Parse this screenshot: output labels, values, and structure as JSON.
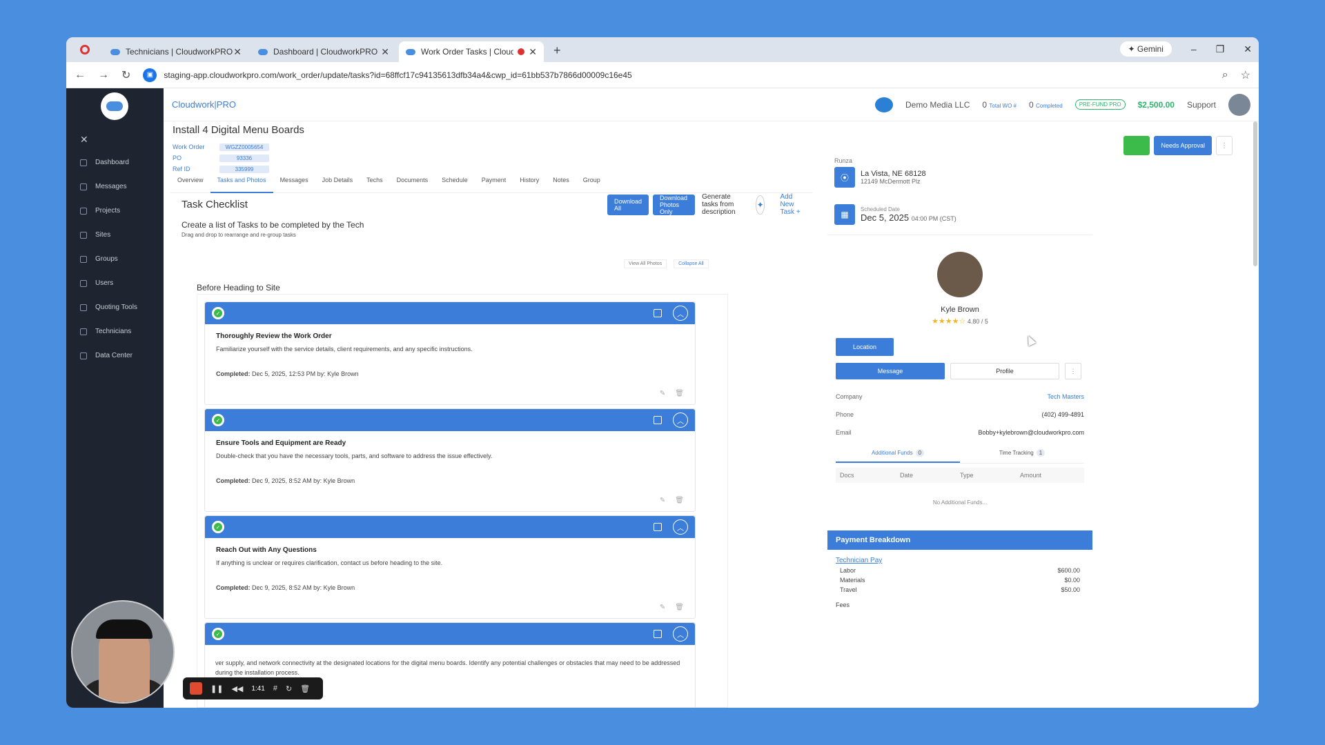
{
  "browser": {
    "tabs": [
      {
        "title": "Technicians | CloudworkPRO"
      },
      {
        "title": "Dashboard | CloudworkPRO"
      },
      {
        "title": "Work Order Tasks | Cloudw"
      }
    ],
    "gemini_label": "Gemini",
    "url": "staging-app.cloudworkpro.com/work_order/update/tasks?id=68ffcf17c94135613dfb34a4&cwp_id=61bb537b7866d00009c16e45"
  },
  "sidebar": {
    "items": [
      {
        "label": "Dashboard",
        "icon": "home-icon"
      },
      {
        "label": "Messages",
        "icon": "chat-icon"
      },
      {
        "label": "Projects",
        "icon": "folder-icon"
      },
      {
        "label": "Sites",
        "icon": "pin-icon"
      },
      {
        "label": "Groups",
        "icon": "hash-icon"
      },
      {
        "label": "Users",
        "icon": "users-icon"
      },
      {
        "label": "Quoting Tools",
        "icon": "doc-icon"
      },
      {
        "label": "Technicians",
        "icon": "id-card-icon"
      },
      {
        "label": "Data Center",
        "icon": "chart-icon"
      }
    ]
  },
  "topbar": {
    "brand_prefix": "Cloudwork|",
    "brand_suffix": "PRO",
    "company": "Demo Media LLC",
    "total_wo_count": "0",
    "total_wo_label": "Total WO #",
    "completed_count": "0",
    "completed_label": "Completed",
    "prefund_label": "PRE-FUND PRO",
    "balance": "$2,500.00",
    "support_label": "Support"
  },
  "work_order": {
    "title": "Install 4 Digital Menu Boards",
    "work_order_label": "Work Order",
    "work_order_value": "WGZZ0005654",
    "po_label": "PO",
    "po_value": "93336",
    "ref_label": "Ref ID",
    "ref_value": "335999",
    "needs_approval_label": "Needs Approval"
  },
  "tabs": [
    "Overview",
    "Tasks and Photos",
    "Messages",
    "Job Details",
    "Techs",
    "Documents",
    "Schedule",
    "Payment",
    "History",
    "Notes",
    "Group"
  ],
  "checklist": {
    "title": "Task Checklist",
    "subtitle": "Create a list of Tasks to be completed by the Tech",
    "hint": "Drag and drop to rearrange and re-group tasks",
    "download_all": "Download All",
    "download_photos": "Download Photos Only",
    "generate_label": "Generate tasks from description",
    "add_task": "Add New Task +",
    "view_all_photos": "View All Photos",
    "collapse_all": "Collapse All",
    "section_title": "Before Heading to Site",
    "tasks": [
      {
        "name": "Thoroughly Review the Work Order",
        "desc": "Familiarize yourself with the service details, client requirements, and any specific instructions.",
        "completed_label": "Completed:",
        "completed_value": "Dec 5, 2025, 12:53 PM by: Kyle Brown"
      },
      {
        "name": "Ensure Tools and Equipment are Ready",
        "desc": "Double-check that you have the necessary tools, parts, and software to address the issue effectively.",
        "completed_label": "Completed:",
        "completed_value": "Dec 9, 2025, 8:52 AM by: Kyle Brown"
      },
      {
        "name": "Reach Out with Any Questions",
        "desc": "If anything is unclear or requires clarification, contact us before heading to the site.",
        "completed_label": "Completed:",
        "completed_value": "Dec 9, 2025, 8:52 AM by: Kyle Brown"
      }
    ],
    "partial_task_desc": "ver supply, and network connectivity at the designated locations for the digital menu boards. Identify any potential challenges or obstacles that may need to be addressed during the installation process."
  },
  "site": {
    "label": "Runza",
    "city": "La Vista, NE 68128",
    "street": "12149 McDermott Plz",
    "scheduled_label": "Scheduled Date",
    "scheduled_date": "Dec 5, 2025",
    "scheduled_time": "04:00 PM (CST)"
  },
  "technician": {
    "name": "Kyle Brown",
    "stars": "★★★★☆",
    "rating": "4.80 / 5",
    "location_btn": "Location",
    "message_btn": "Message",
    "profile_btn": "Profile",
    "company_label": "Company",
    "company_value": "Tech Masters",
    "phone_label": "Phone",
    "phone_value": "(402) 499-4891",
    "email_label": "Email",
    "email_value": "Bobby+kylebrown@cloudworkpro.com"
  },
  "funds": {
    "tab_additional": "Additional Funds",
    "tab_additional_count": "0",
    "tab_time": "Time Tracking",
    "tab_time_count": "1",
    "columns": [
      "Docs",
      "Date",
      "Type",
      "Amount"
    ],
    "empty": "No Additional Funds..."
  },
  "payment": {
    "title": "Payment Breakdown",
    "tech_pay_label": "Technician Pay",
    "rows": [
      {
        "label": "Labor",
        "value": "$600.00"
      },
      {
        "label": "Materials",
        "value": "$0.00"
      },
      {
        "label": "Travel",
        "value": "$50.00"
      }
    ],
    "fees_label": "Fees"
  },
  "recorder": {
    "time": "1:41"
  }
}
